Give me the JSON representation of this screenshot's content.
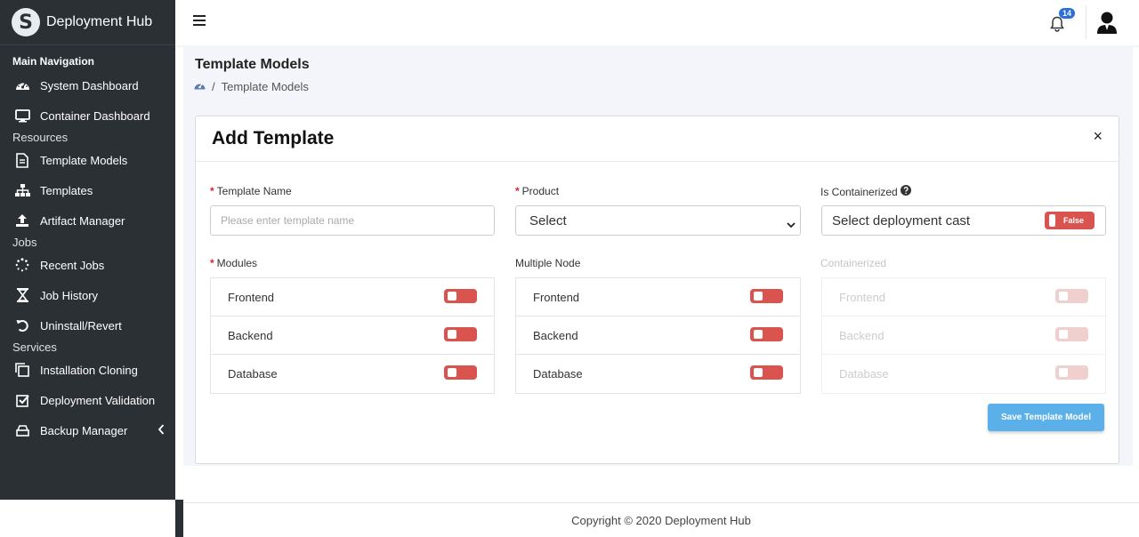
{
  "app": {
    "name": "Deployment Hub",
    "logo_letter": "S"
  },
  "sidebar": {
    "header": "Main Navigation",
    "sections": {
      "resources": "Resources",
      "jobs": "Jobs",
      "services": "Services"
    },
    "items": [
      {
        "label": "System Dashboard",
        "icon": "dashboard-icon"
      },
      {
        "label": "Container Dashboard",
        "icon": "monitor-icon"
      },
      {
        "label": "Template Models",
        "icon": "document-icon"
      },
      {
        "label": "Templates",
        "icon": "sitemap-icon"
      },
      {
        "label": "Artifact Manager",
        "icon": "upload-icon"
      },
      {
        "label": "Recent Jobs",
        "icon": "spinner-icon"
      },
      {
        "label": "Job History",
        "icon": "hourglass-icon"
      },
      {
        "label": "Uninstall/Revert",
        "icon": "undo-icon"
      },
      {
        "label": "Installation Cloning",
        "icon": "clone-icon"
      },
      {
        "label": "Deployment Validation",
        "icon": "check-square-icon"
      },
      {
        "label": "Backup Manager",
        "icon": "drive-icon"
      }
    ]
  },
  "topbar": {
    "notification_count": "14"
  },
  "page": {
    "title": "Template Models",
    "breadcrumb": "Template Models"
  },
  "card": {
    "title": "Add Template",
    "close_label": "×",
    "template_name": {
      "label": "Template Name",
      "placeholder": "Please enter template name"
    },
    "product": {
      "label": "Product",
      "value": "Select"
    },
    "is_containerized": {
      "label": "Is Containerized",
      "value": "Select deployment cast",
      "toggle_label": "False"
    },
    "modules": {
      "label": "Modules",
      "items": [
        "Frontend",
        "Backend",
        "Database"
      ]
    },
    "multiple_node": {
      "label": "Multiple Node",
      "items": [
        "Frontend",
        "Backend",
        "Database"
      ]
    },
    "containerized": {
      "label": "Containerized",
      "items": [
        "Frontend",
        "Backend",
        "Database"
      ]
    },
    "save_label": "Save Template Model"
  },
  "footer": {
    "copyright": "Copyright © 2020 Deployment Hub"
  },
  "colors": {
    "sidebar_bg": "#2b3035",
    "toggle_off": "#d9534f",
    "primary_button": "#5bb0ea",
    "badge": "#2a6fdb"
  }
}
